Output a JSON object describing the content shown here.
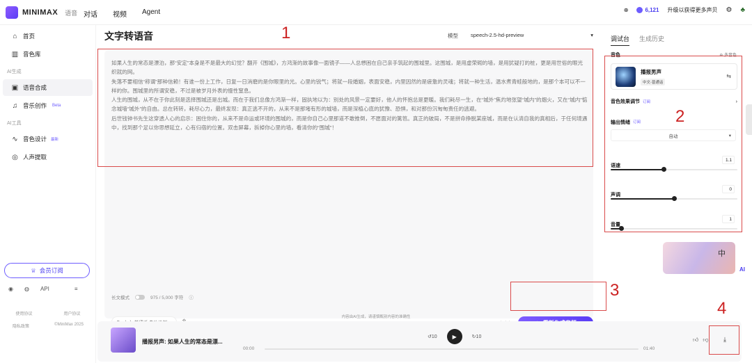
{
  "brand": {
    "name": "MINIMAX",
    "sub": "语音"
  },
  "topnav": [
    "对话",
    "视频",
    "Agent"
  ],
  "topright": {
    "credits": "6,121",
    "upgrade": "升级以获得更多声贝"
  },
  "sidebar": {
    "home": "首页",
    "library": "音色库",
    "group_ai": "AI生成",
    "tts": "语音合成",
    "music": "音乐创作",
    "beta": "Beta",
    "group_tools": "AI工具",
    "design": "音色设计",
    "new": "最新",
    "extract": "人声提取",
    "vip": "会员订阅",
    "api": "API",
    "footer": [
      [
        "使用协议",
        "用户协议"
      ],
      [
        "隐私政策",
        "©MiniMax 2025"
      ]
    ]
  },
  "main": {
    "title": "文字转语音",
    "model_label": "模型",
    "model_value": "speech-2.5-hd-preview",
    "paragraphs": [
      "如果人生的常态是漂泊，那“安定”本身是不是最大的幻觉？翻开《围城》，方鸿渐的故事像一面镜子——人总想困在自己亲手筑起的围城里。这围城，是用虚荣砌的墙，是用犹疑打的桩，更是用世俗的眼光织就的网。",
      "失落不要相信“称谓”那种信赖！有谁一份上工作，日复一日消磨的是你眼里的光。心里的锐气；将就一段婚姻，表面安稳，内里因然的是疲惫的灵魂；将就一种生活，温水煮青蛙般地的，是那个本可以不一样的你。围城里的所谓安稳，不过是被岁月外表的慢性窒息。",
      "人生的围城，从不在于你此刻是选择围城还是出城。而在于我们总像方鸿渐一样，固执地以为：别处的风景一定要好，他人的怀抱总是更暖。我们耗尽一生，在“城外”焦灼地张望“城内”的烟火，又在“城内”惦念城墙“城外”的自由。总在转转，耗尽心力，最终发现：真正逃不开的，从来不是那堵有形的城墙，而是深植心底的犹豫、恐惧，和对那份沉甸甸责任的逃避。",
      "后世钱钟书先生这穿透人心的启示：困住你的，从来不是命运或环境的围城的，而是你自己心里那道不敢推倒，不愿面对的篱笆。真正的破局，不是拼命挣脱某座城，而是在认清自我的真相后，于任何境遇中，找到那个足以你思想延立，心有归宿的位置。双击屏幕，拆掉你心里的墙，看清你的“围城”！"
    ],
    "long_text_mode": "长文模式",
    "char_count": "975 / 5,000 字符",
    "lang": "中文-普通话 自动检测",
    "review_label": "历史音频",
    "regen": "重新生成音频"
  },
  "right": {
    "tab_debug": "调试台",
    "tab_history": "生成历史",
    "voice_section": "音色",
    "voice_more": "多音色",
    "voice_name": "播报男声",
    "voice_tag": "中文-普通话",
    "effect": "音色效果调节",
    "emotion": "输出情绪",
    "emotion_value": "自动",
    "sub": "订阅",
    "speed_label": "语速",
    "speed_value": "1.1",
    "speed": 0.42,
    "pitch_label": "声调",
    "pitch_value": "0",
    "pitch": 0.5,
    "volume_label": "音量",
    "volume_value": "1",
    "volume": 0.08
  },
  "mascot_char": "中",
  "disclaimer": "内容由AI生成，请谨慎甄别内容的准确性",
  "player": {
    "title": "播报男声: 如果人生的常态是漂...",
    "t0": "00:00",
    "t1": "01:40",
    "skip": "10"
  },
  "annotations": [
    "1",
    "2",
    "3",
    "4"
  ],
  "colors": {
    "accent": "#5a3df5",
    "annot": "#cc2222"
  }
}
